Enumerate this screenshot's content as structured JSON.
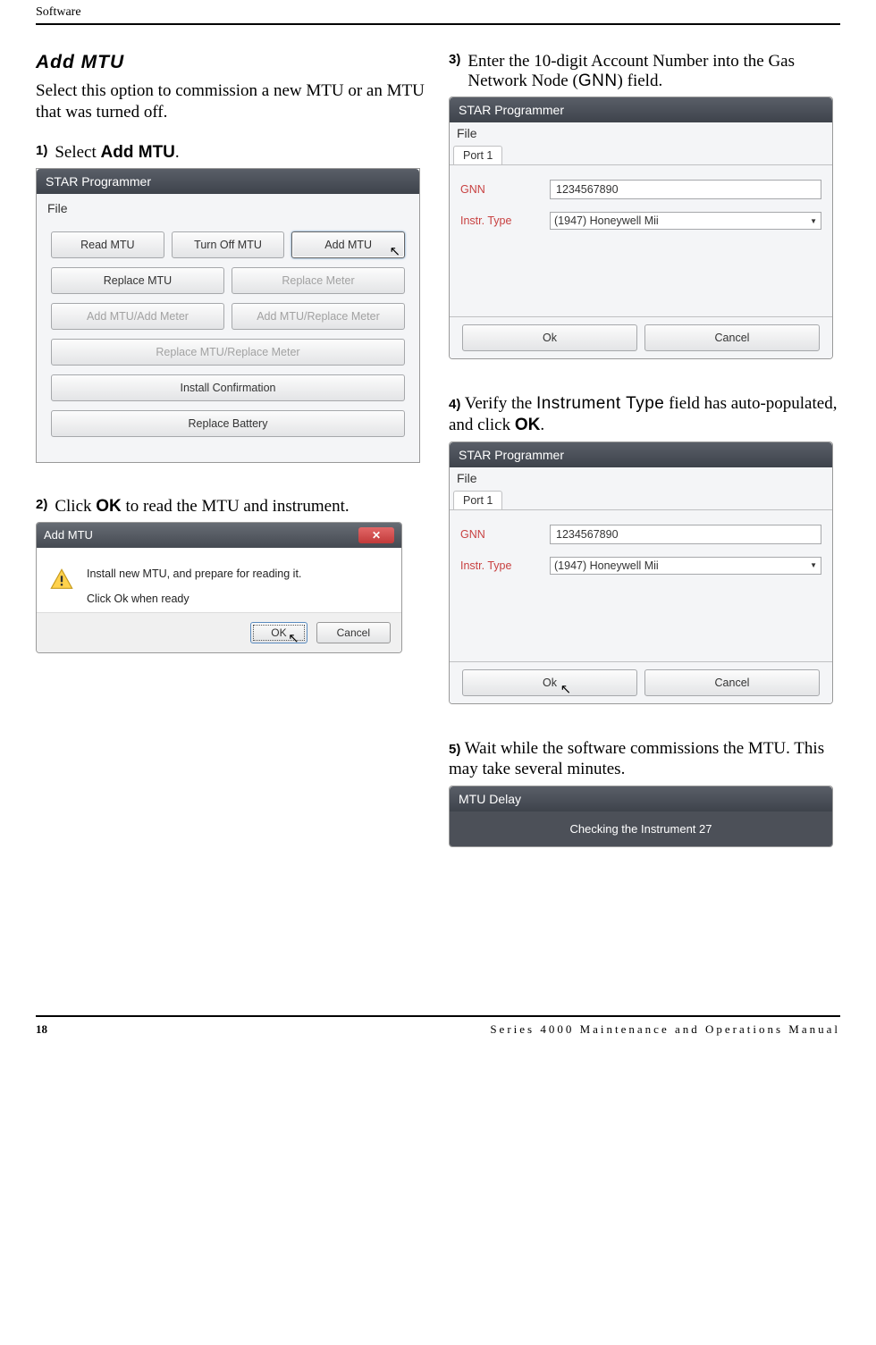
{
  "header": {
    "section": "Software"
  },
  "left": {
    "heading": "Add MTU",
    "intro": "Select this option to commission a new MTU or an MTU that was turned off.",
    "step1_num": "1)",
    "step1_pre": "Select ",
    "step1_bold": "Add MTU",
    "step1_post": ".",
    "sc1": {
      "title": "STAR Programmer",
      "menu": "File",
      "buttons": {
        "read": "Read MTU",
        "off": "Turn Off MTU",
        "add": "Add MTU",
        "replace_mtu": "Replace MTU",
        "replace_meter": "Replace Meter",
        "add_add": "Add MTU/Add Meter",
        "add_replace": "Add MTU/Replace Meter",
        "rep_rep": "Replace MTU/Replace Meter",
        "install": "Install Confirmation",
        "battery": "Replace Battery"
      }
    },
    "step2_num": "2)",
    "step2_pre": "Click ",
    "step2_bold": "OK",
    "step2_post": " to read the MTU and instrument.",
    "sc2": {
      "title": "Add MTU",
      "line1": "Install new MTU, and prepare for reading it.",
      "line2": "Click Ok when ready",
      "ok": "OK",
      "cancel": "Cancel"
    }
  },
  "right": {
    "step3_num": "3)",
    "step3_pre": "Enter the 10-digit Account Number into the Gas Network Node (",
    "step3_sans": "GNN",
    "step3_post": ") field.",
    "sc3": {
      "title": "STAR Programmer",
      "menu": "File",
      "tab": "Port 1",
      "gnn_label": "GNN",
      "gnn_value": "1234567890",
      "instr_label": "Instr. Type",
      "instr_value": "(1947) Honeywell Mii",
      "ok": "Ok",
      "cancel": "Cancel"
    },
    "step4_num": "4)",
    "step4_pre": " Verify the ",
    "step4_sans": "Instrument Type",
    "step4_mid": " field has auto-populated, and click ",
    "step4_bold": "OK",
    "step4_post": ".",
    "sc4": {
      "title": "STAR Programmer",
      "menu": "File",
      "tab": "Port 1",
      "gnn_label": "GNN",
      "gnn_value": "1234567890",
      "instr_label": "Instr. Type",
      "instr_value": "(1947) Honeywell Mii",
      "ok": "Ok",
      "cancel": "Cancel"
    },
    "step5_num": "5)",
    "step5_text": " Wait while the software commissions the MTU. This may take several minutes.",
    "sc5": {
      "title": "MTU Delay",
      "msg": "Checking the Instrument 27"
    }
  },
  "footer": {
    "page": "18",
    "manual": "Series 4000 Maintenance and Operations Manual"
  }
}
